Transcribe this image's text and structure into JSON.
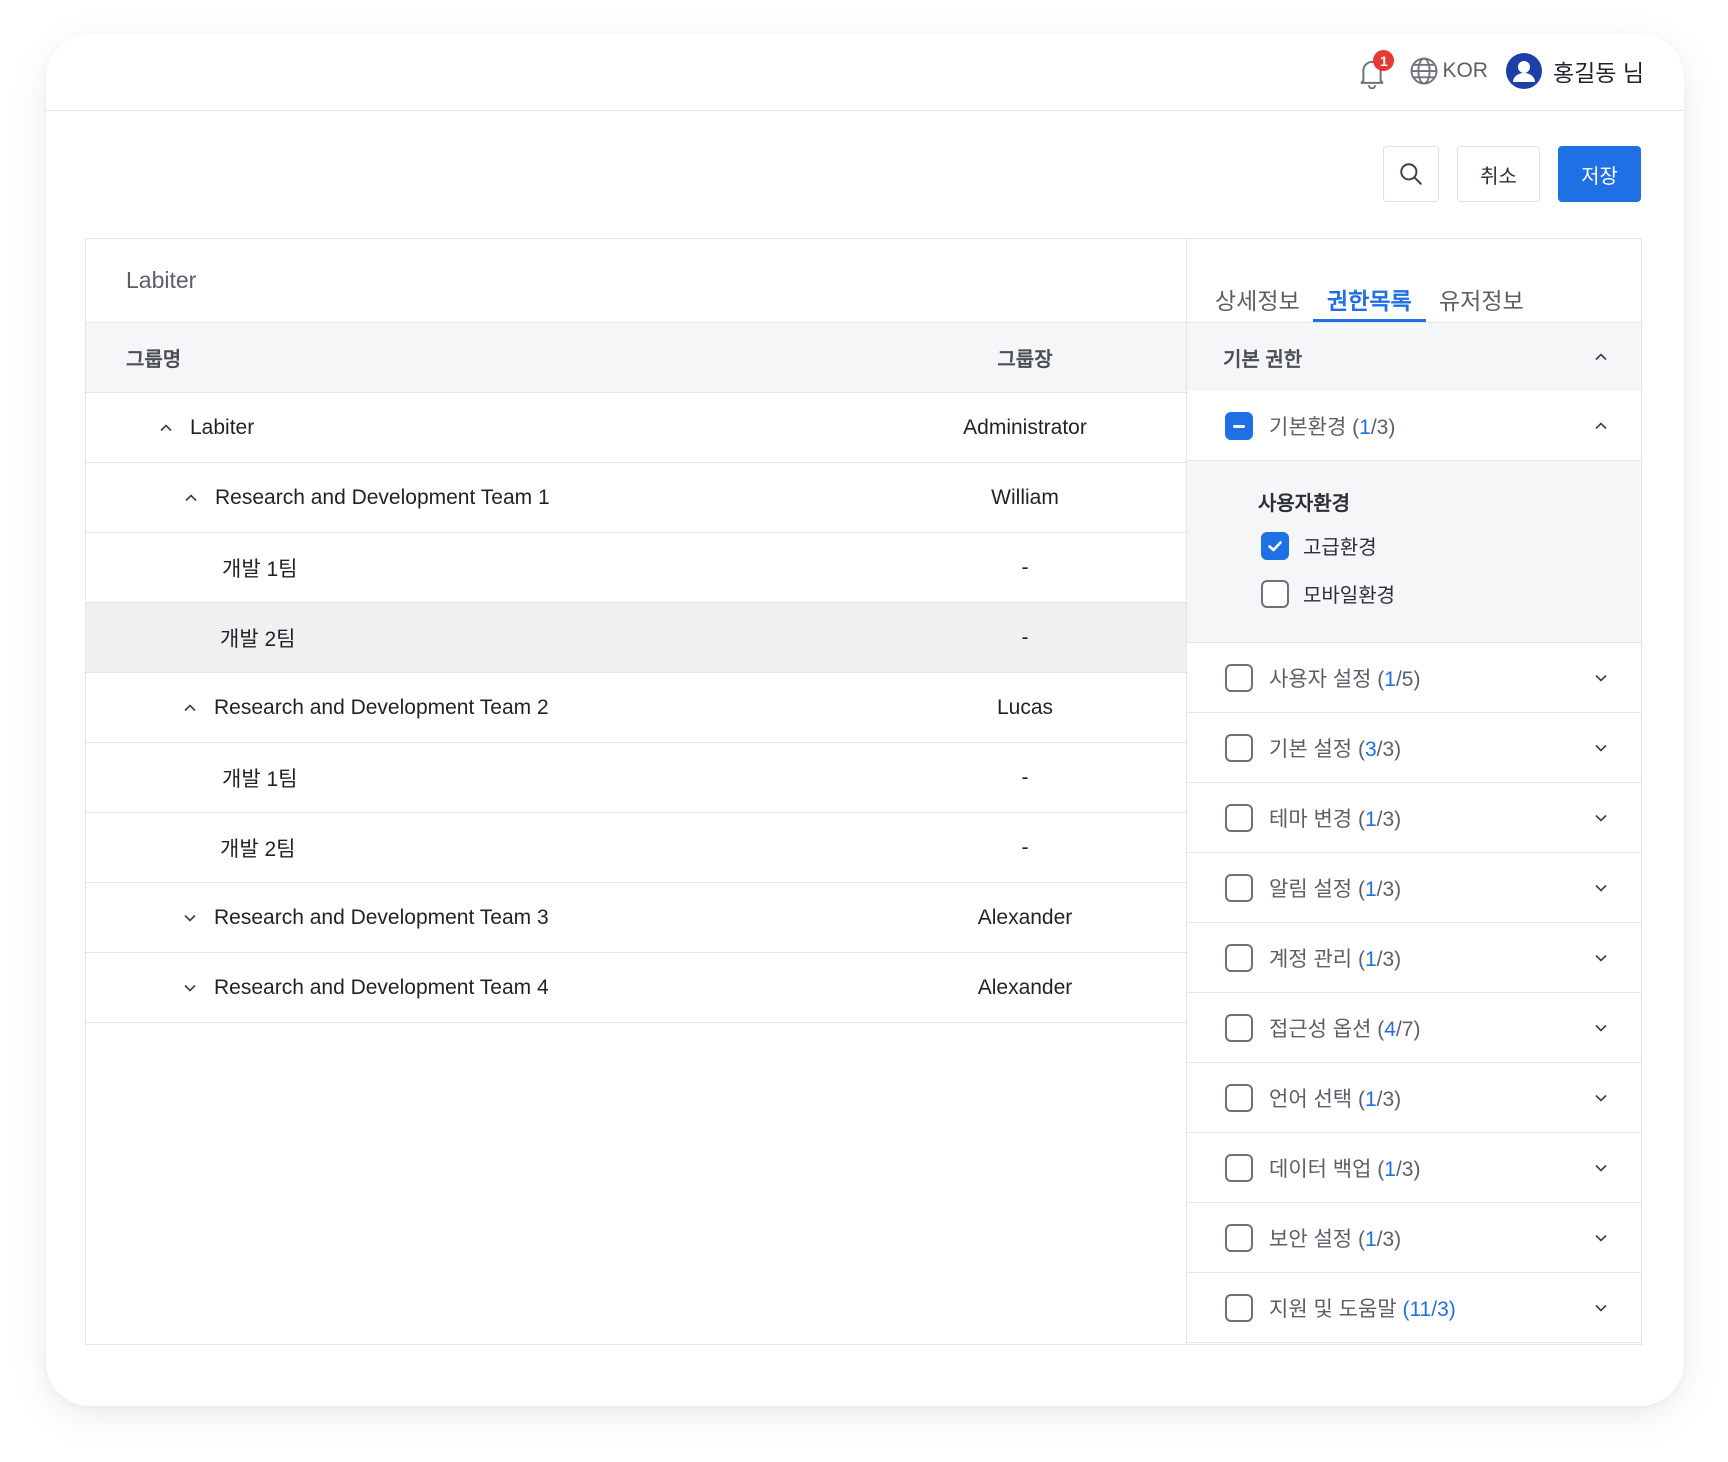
{
  "header": {
    "notification_count": "1",
    "language": "KOR",
    "user_name": "홍길동 님"
  },
  "actions": {
    "cancel_label": "취소",
    "save_label": "저장"
  },
  "left": {
    "title": "Labiter",
    "columns": {
      "name": "그룹명",
      "lead": "그룹장"
    },
    "rows": [
      {
        "name": "Labiter",
        "lead": "Administrator"
      },
      {
        "name": "Research and Development Team 1",
        "lead": "William"
      },
      {
        "name": "개발 1팀",
        "lead": "-"
      },
      {
        "name": "개발 2팀",
        "lead": "-"
      },
      {
        "name": "Research and Development Team 2",
        "lead": "Lucas"
      },
      {
        "name": "개발 1팀",
        "lead": "-"
      },
      {
        "name": "개발 2팀",
        "lead": "-"
      },
      {
        "name": "Research and Development Team 3",
        "lead": "Alexander"
      },
      {
        "name": "Research and Development Team 4",
        "lead": "Alexander"
      }
    ]
  },
  "right": {
    "tabs": [
      "상세정보",
      "권한목록",
      "유저정보"
    ],
    "section_title": "기본 권한",
    "expanded": {
      "label": "기본환경",
      "count_open": "(",
      "count_sel": "1",
      "count_rest": "/3)",
      "sub_title": "사용자환경",
      "sub_items": [
        "고급환경",
        "모바일환경"
      ]
    },
    "perms": [
      {
        "label": "사용자 설정",
        "sel": "1",
        "total": "/5)"
      },
      {
        "label": "기본 설정",
        "sel": "3",
        "total": "/3)"
      },
      {
        "label": "테마 변경",
        "sel": "1",
        "total": "/3)"
      },
      {
        "label": "알림 설정",
        "sel": "1",
        "total": "/3)"
      },
      {
        "label": "계정 관리",
        "sel": "1",
        "total": "/3)"
      },
      {
        "label": "접근성 옵션",
        "sel": "4",
        "total": "/7)"
      },
      {
        "label": "언어 선택",
        "sel": "1",
        "total": "/3)"
      },
      {
        "label": "데이터 백업",
        "sel": "1",
        "total": "/3)"
      },
      {
        "label": "보안 설정",
        "sel": "1",
        "total": "/3)"
      },
      {
        "label": "지원 및 도움말",
        "sel": "11/3",
        "total": ")"
      }
    ]
  },
  "colors": {
    "accent": "#1f6fe5",
    "badge": "#e53935"
  },
  "icons": [
    "bell-icon",
    "globe-icon",
    "user-icon",
    "search-icon",
    "chevron-up-icon",
    "chevron-down-icon",
    "check-icon"
  ]
}
